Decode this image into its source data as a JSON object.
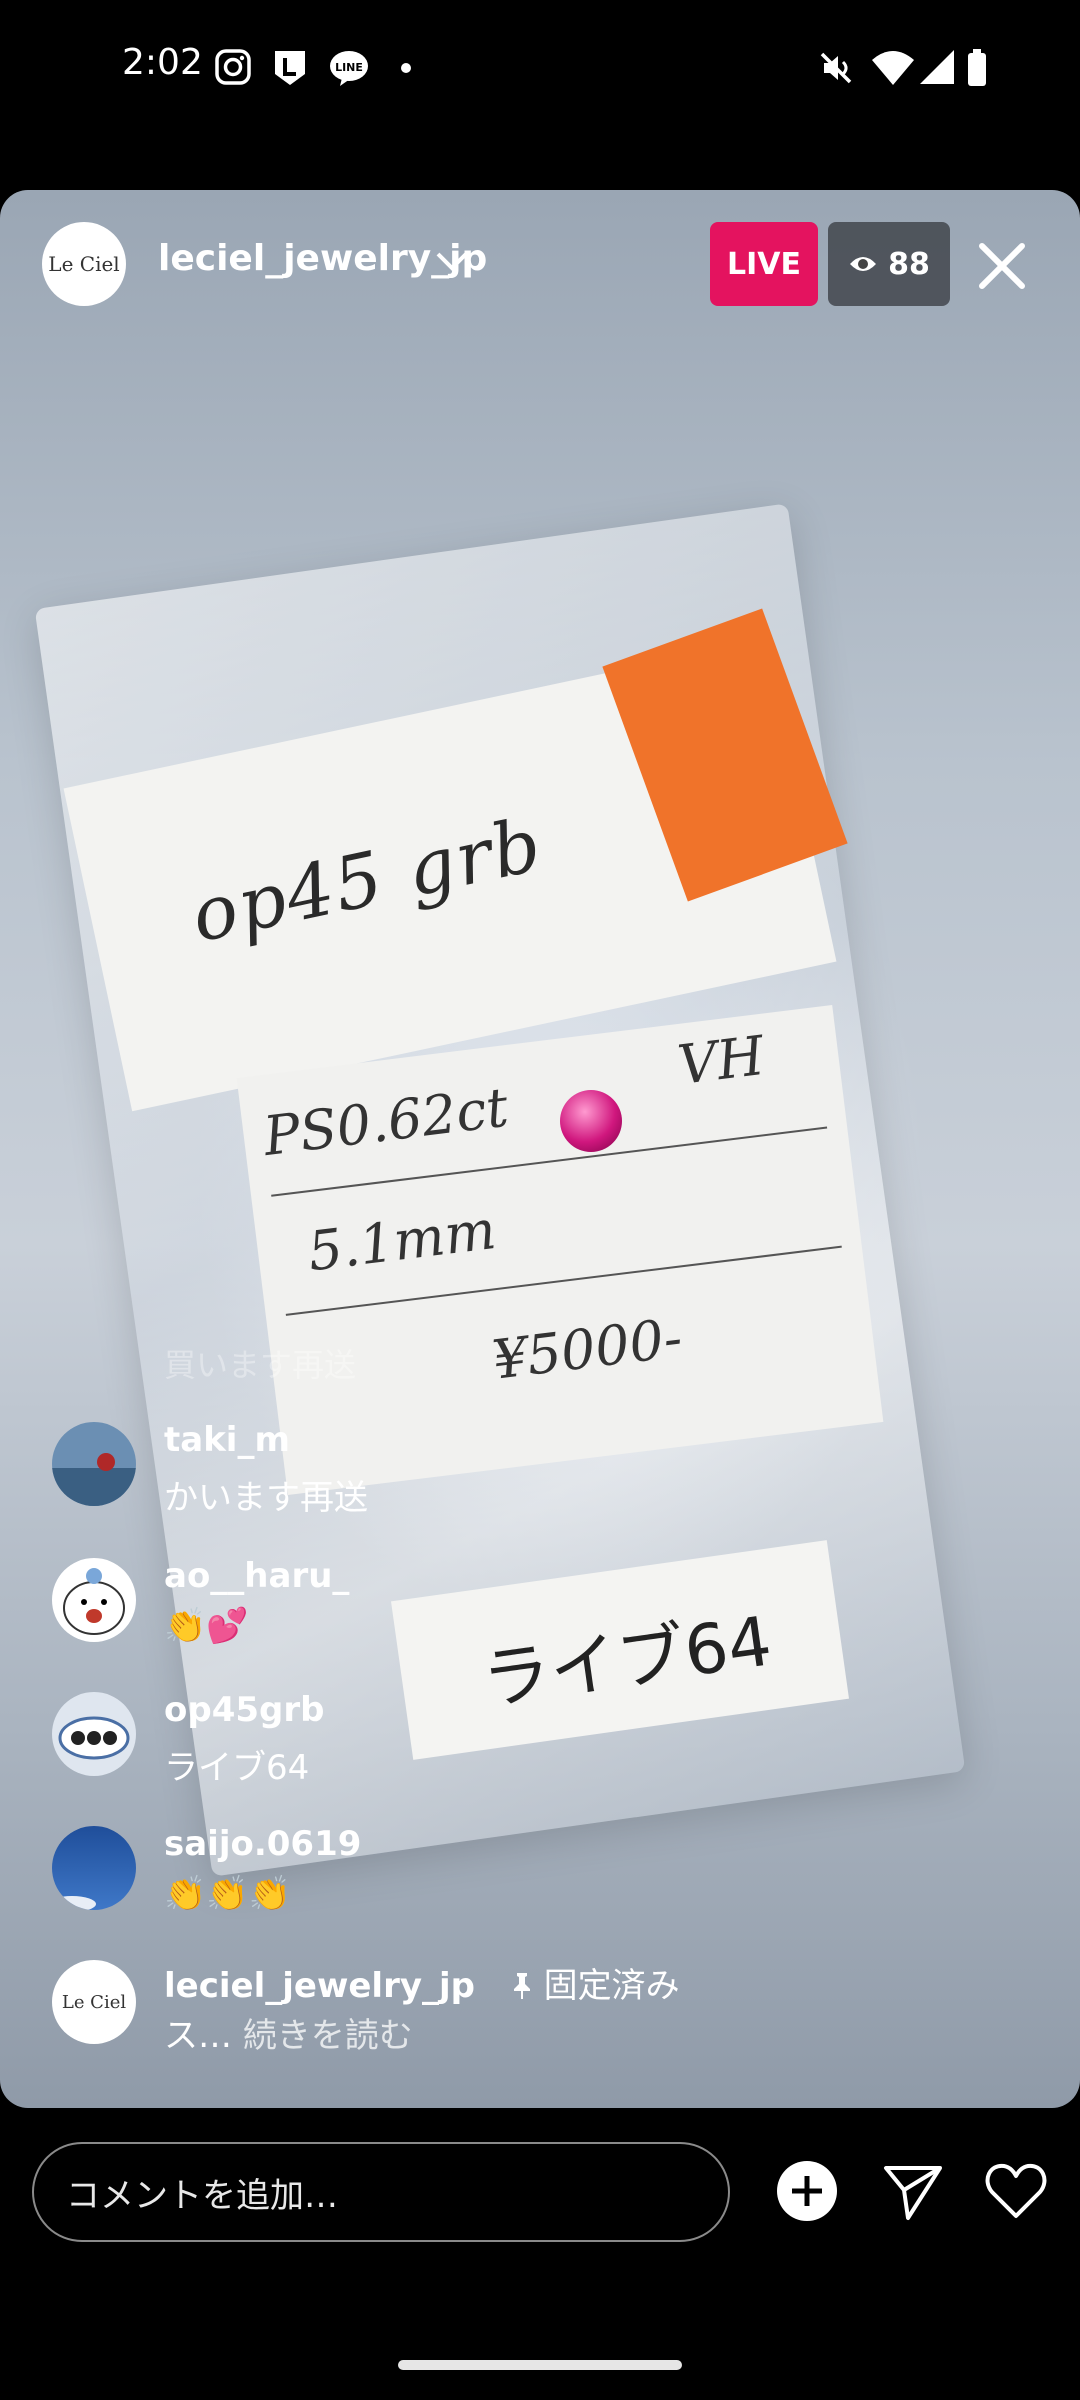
{
  "status_bar": {
    "time": "2:02",
    "notification_icons": [
      "instagram-icon",
      "l-app-icon",
      "line-icon",
      "dot-icon"
    ],
    "system_icons": [
      "mute-icon",
      "wifi-icon",
      "signal-icon",
      "battery-icon"
    ]
  },
  "header": {
    "avatar_text": "Le Ciel",
    "username": "leciel_jewelry_jp",
    "live_label": "LIVE",
    "viewer_count": "88"
  },
  "comments": {
    "faded_text": "買います再送",
    "items": [
      {
        "user": "taki_m",
        "text": "かいます再送"
      },
      {
        "user": "ao__haru_",
        "text": "👏💕"
      },
      {
        "user": "op45grb",
        "text": "ライブ64"
      },
      {
        "user": "saijo.0619",
        "text": "👏👏👏"
      }
    ],
    "pinned": {
      "user": "leciel_jewelry_jp",
      "pinned_label": "固定済み",
      "text": "ス…",
      "read_more": "続きを読む"
    }
  },
  "footer": {
    "comment_placeholder": "コメントを追加…"
  },
  "colors": {
    "live_badge": "#e4135f",
    "background": "#000000"
  }
}
